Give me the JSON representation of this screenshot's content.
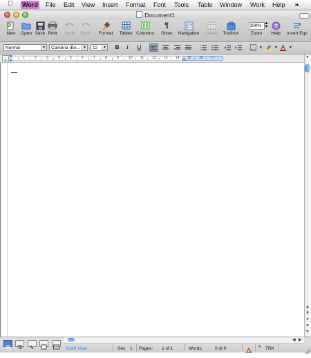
{
  "menubar": {
    "items": [
      "Word",
      "File",
      "Edit",
      "View",
      "Insert",
      "Format",
      "Font",
      "Tools",
      "Table",
      "Window",
      "Work",
      "Help"
    ]
  },
  "window": {
    "title": "Document1"
  },
  "toolbar": {
    "buttons": [
      {
        "label": "New",
        "icon": "new-doc-icon",
        "enabled": true
      },
      {
        "label": "Open",
        "icon": "open-folder-icon",
        "enabled": true
      },
      {
        "label": "Save",
        "icon": "save-disk-icon",
        "enabled": true
      },
      {
        "label": "Print",
        "icon": "printer-icon",
        "enabled": true
      },
      {
        "label": "Undo",
        "icon": "undo-icon",
        "enabled": false
      },
      {
        "label": "Redo",
        "icon": "redo-icon",
        "enabled": false
      },
      {
        "label": "Format",
        "icon": "format-brush-icon",
        "enabled": true
      },
      {
        "label": "Tables",
        "icon": "table-grid-icon",
        "enabled": true
      },
      {
        "label": "Columns",
        "icon": "columns-icon",
        "enabled": true
      },
      {
        "label": "Show",
        "icon": "pilcrow-icon",
        "enabled": true
      },
      {
        "label": "Navigation",
        "icon": "navigation-icon",
        "enabled": true
      },
      {
        "label": "Gallery",
        "icon": "gallery-icon",
        "enabled": false
      },
      {
        "label": "Toolbox",
        "icon": "toolbox-icon",
        "enabled": true
      },
      {
        "label": "Zoom",
        "icon": "zoom-icon",
        "enabled": true
      },
      {
        "label": "Help",
        "icon": "help-icon",
        "enabled": true
      },
      {
        "label": "Insert Eqn",
        "icon": "equation-icon",
        "enabled": true
      }
    ],
    "zoom_value": "100%"
  },
  "formatting": {
    "style": "Normal",
    "font": "Cambria (Bo...",
    "size": "12",
    "bold": "B",
    "italic": "I",
    "underline": "U",
    "font_color": "A",
    "highlight_color": "#f5e63a",
    "font_color_swatch": "#d40000"
  },
  "ruler": {
    "numbers": [
      "1",
      "2",
      "3",
      "4",
      "5",
      "6",
      "7",
      "8",
      "9",
      "10",
      "11",
      "12",
      "13",
      "14",
      "15",
      "16",
      "17"
    ]
  },
  "status": {
    "view_name": "Draft View",
    "sec_label": "Sec",
    "sec_value": "1",
    "pages_label": "Pages:",
    "pages_value": "1 of 1",
    "words_label": "Words:",
    "words_value": "0 of 0",
    "trk_label": "TRK"
  },
  "colors": {
    "accent_blue": "#3f7bd0",
    "menu_highlight": "#cf7ecf"
  }
}
